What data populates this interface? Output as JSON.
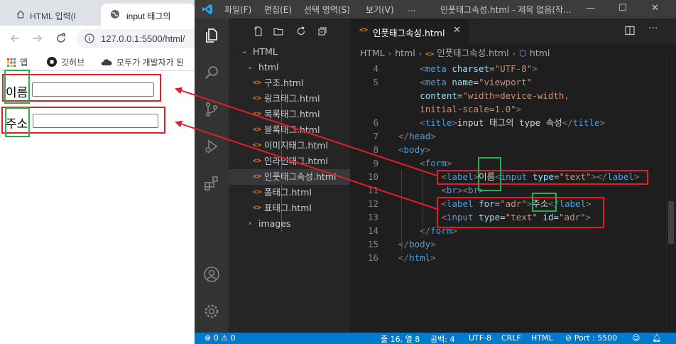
{
  "browser": {
    "tabs": [
      {
        "label": "HTML 입력(I",
        "icon": "home-icon"
      },
      {
        "label": "input 태그의",
        "icon": "globe-icon"
      }
    ],
    "address": "127.0.0.1:5500/html/",
    "bookmarks": [
      {
        "label": "앱",
        "icon": "apps-grid-icon"
      },
      {
        "label": "깃허브",
        "icon": "github-icon"
      },
      {
        "label": "모두가 개발자가 된",
        "icon": "cloud-icon"
      }
    ],
    "page": {
      "name_label": "이름",
      "address_label": "주소",
      "name_value": "",
      "address_value": ""
    }
  },
  "vscode": {
    "menu": [
      "파일(F)",
      "편집(E)",
      "선택 영역(S)",
      "보기(V)",
      "..."
    ],
    "window_title": "인풋태그속성.html - 제목 없음(작...",
    "explorer": {
      "root": "HTML",
      "folder": "html",
      "files": [
        "구조.html",
        "링크태그.html",
        "목록태그.html",
        "블록태그.html",
        "이미지태그.html",
        "인라인태그.html",
        "인풋태그속성.html",
        "폼태그.html",
        "표태그.html"
      ],
      "active_file": "인풋태그속성.html",
      "subfolder": "images"
    },
    "editor_tab": "인풋태그속성.html",
    "breadcrumbs": [
      "HTML",
      "html",
      "인풋태그속성.html",
      "html"
    ],
    "code_lines": [
      {
        "n": "4",
        "indent": 2,
        "tokens": [
          [
            "t-br",
            "<"
          ],
          [
            "t-tag",
            "meta"
          ],
          [
            "t-txt",
            " "
          ],
          [
            "t-attr",
            "charset"
          ],
          [
            "t-txt",
            "="
          ],
          [
            "t-str",
            "\"UTF-8\""
          ],
          [
            "t-br",
            ">"
          ]
        ]
      },
      {
        "n": "5",
        "indent": 2,
        "tokens": [
          [
            "t-br",
            "<"
          ],
          [
            "t-tag",
            "meta"
          ],
          [
            "t-txt",
            " "
          ],
          [
            "t-attr",
            "name"
          ],
          [
            "t-txt",
            "="
          ],
          [
            "t-str",
            "\"viewport\""
          ]
        ]
      },
      {
        "n": "",
        "indent": 2,
        "tokens": [
          [
            "t-attr",
            "content"
          ],
          [
            "t-txt",
            "="
          ],
          [
            "t-str",
            "\"width=device-width,"
          ]
        ]
      },
      {
        "n": "",
        "indent": 2,
        "tokens": [
          [
            "t-str",
            "initial-scale=1.0\""
          ],
          [
            "t-br",
            ">"
          ]
        ]
      },
      {
        "n": "6",
        "indent": 2,
        "tokens": [
          [
            "t-br",
            "<"
          ],
          [
            "t-tag",
            "title"
          ],
          [
            "t-br",
            ">"
          ],
          [
            "t-txt",
            "input 태그의 type 속성"
          ],
          [
            "t-br",
            "</"
          ],
          [
            "t-tag",
            "title"
          ],
          [
            "t-br",
            ">"
          ]
        ]
      },
      {
        "n": "7",
        "indent": 0,
        "tokens": [
          [
            "t-br",
            "</"
          ],
          [
            "t-tag",
            "head"
          ],
          [
            "t-br",
            ">"
          ]
        ]
      },
      {
        "n": "8",
        "indent": 0,
        "tokens": [
          [
            "t-br",
            "<"
          ],
          [
            "t-tag",
            "body"
          ],
          [
            "t-br",
            ">"
          ]
        ]
      },
      {
        "n": "9",
        "indent": 2,
        "tokens": [
          [
            "t-br",
            "<"
          ],
          [
            "t-tag",
            "form"
          ],
          [
            "t-br",
            ">"
          ]
        ]
      },
      {
        "n": "10",
        "indent": 4,
        "tokens": [
          [
            "t-br",
            "<"
          ],
          [
            "t-tag",
            "label"
          ],
          [
            "t-br",
            ">"
          ],
          [
            "t-txt",
            "이름"
          ],
          [
            "t-br",
            "<"
          ],
          [
            "t-tag",
            "input"
          ],
          [
            "t-txt",
            " "
          ],
          [
            "t-attr",
            "type"
          ],
          [
            "t-txt",
            "="
          ],
          [
            "t-str",
            "\"text\""
          ],
          [
            "t-br",
            ">"
          ],
          [
            "t-br",
            "</"
          ],
          [
            "t-tag",
            "label"
          ],
          [
            "t-br",
            ">"
          ]
        ]
      },
      {
        "n": "11",
        "indent": 4,
        "tokens": [
          [
            "t-br",
            "<"
          ],
          [
            "t-tag",
            "br"
          ],
          [
            "t-br",
            "><"
          ],
          [
            "t-tag",
            "br"
          ],
          [
            "t-br",
            ">"
          ]
        ]
      },
      {
        "n": "12",
        "indent": 4,
        "tokens": [
          [
            "t-br",
            "<"
          ],
          [
            "t-tag",
            "label"
          ],
          [
            "t-txt",
            " "
          ],
          [
            "t-attr",
            "for"
          ],
          [
            "t-txt",
            "="
          ],
          [
            "t-str",
            "\"adr\""
          ],
          [
            "t-br",
            ">"
          ],
          [
            "t-txt",
            "주소"
          ],
          [
            "t-br",
            "</"
          ],
          [
            "t-tag",
            "label"
          ],
          [
            "t-br",
            ">"
          ]
        ]
      },
      {
        "n": "13",
        "indent": 4,
        "tokens": [
          [
            "t-br",
            "<"
          ],
          [
            "t-tag",
            "input"
          ],
          [
            "t-txt",
            " "
          ],
          [
            "t-attr",
            "type"
          ],
          [
            "t-txt",
            "="
          ],
          [
            "t-str",
            "\"text\""
          ],
          [
            "t-txt",
            " "
          ],
          [
            "t-attr",
            "id"
          ],
          [
            "t-txt",
            "="
          ],
          [
            "t-str",
            "\"adr\""
          ],
          [
            "t-br",
            ">"
          ]
        ]
      },
      {
        "n": "14",
        "indent": 2,
        "tokens": [
          [
            "t-br",
            "</"
          ],
          [
            "t-tag",
            "form"
          ],
          [
            "t-br",
            ">"
          ]
        ]
      },
      {
        "n": "15",
        "indent": 0,
        "tokens": [
          [
            "t-br",
            "</"
          ],
          [
            "t-tag",
            "body"
          ],
          [
            "t-br",
            ">"
          ]
        ]
      },
      {
        "n": "16",
        "indent": 0,
        "tokens": [
          [
            "t-br",
            "</"
          ],
          [
            "t-tag",
            "html"
          ],
          [
            "t-br",
            ">"
          ]
        ]
      }
    ],
    "status": {
      "problems": "⊗ 0 ⚠ 0",
      "position": "줄 16, 열 8",
      "spaces": "공백: 4",
      "encoding": "UTF-8",
      "eol": "CRLF",
      "language": "HTML",
      "port": "Port : 5500"
    }
  },
  "colors": {
    "annotation_red": "#e11d2a",
    "annotation_green": "#22b14c",
    "vscode_status": "#007acc"
  }
}
